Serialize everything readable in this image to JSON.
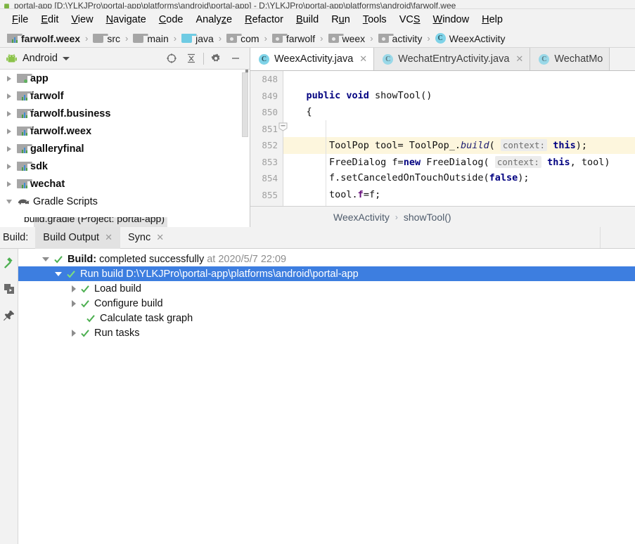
{
  "window": {
    "title": "portal-app [D:\\YLKJPro\\portal-app\\platforms\\android\\portal-app] - D:\\YLKJPro\\portal-app\\platforms\\android\\farwolf.wee",
    "app_icon": "android-icon"
  },
  "menubar": {
    "items": [
      {
        "label": "File",
        "mnemonic": "F"
      },
      {
        "label": "Edit",
        "mnemonic": "E"
      },
      {
        "label": "View",
        "mnemonic": "V"
      },
      {
        "label": "Navigate",
        "mnemonic": "N"
      },
      {
        "label": "Code",
        "mnemonic": "C"
      },
      {
        "label": "Analyze",
        "mnemonic": "z"
      },
      {
        "label": "Refactor",
        "mnemonic": "R"
      },
      {
        "label": "Build",
        "mnemonic": "B"
      },
      {
        "label": "Run",
        "mnemonic": "u"
      },
      {
        "label": "Tools",
        "mnemonic": "T"
      },
      {
        "label": "VCS",
        "mnemonic": "S"
      },
      {
        "label": "Window",
        "mnemonic": "W"
      },
      {
        "label": "Help",
        "mnemonic": "H"
      }
    ]
  },
  "breadcrumb": {
    "items": [
      {
        "label": "farwolf.weex",
        "icon": "module-icon",
        "bold": true
      },
      {
        "label": "src",
        "icon": "folder-icon"
      },
      {
        "label": "main",
        "icon": "folder-icon"
      },
      {
        "label": "java",
        "icon": "folder-source-icon"
      },
      {
        "label": "com",
        "icon": "package-icon"
      },
      {
        "label": "farwolf",
        "icon": "package-icon"
      },
      {
        "label": "weex",
        "icon": "package-icon"
      },
      {
        "label": "activity",
        "icon": "package-icon"
      },
      {
        "label": "WeexActivity",
        "icon": "class-icon"
      }
    ],
    "separator": "›"
  },
  "project_panel": {
    "header": {
      "view_name": "Android",
      "dropdown_icon": "chevron-down-icon",
      "tools": [
        {
          "name": "select-opened-file-icon"
        },
        {
          "name": "collapse-all-icon"
        },
        {
          "name": "gear-icon"
        },
        {
          "name": "hide-icon"
        }
      ]
    },
    "tree": [
      {
        "label": "app",
        "icon": "app-module-icon",
        "expander": "right"
      },
      {
        "label": "farwolf",
        "icon": "module-icon",
        "expander": "right"
      },
      {
        "label": "farwolf.business",
        "icon": "module-icon",
        "expander": "right"
      },
      {
        "label": "farwolf.weex",
        "icon": "module-icon",
        "expander": "right"
      },
      {
        "label": "galleryfinal",
        "icon": "module-icon",
        "expander": "right"
      },
      {
        "label": "sdk",
        "icon": "module-icon",
        "expander": "right"
      },
      {
        "label": "wechat",
        "icon": "module-icon",
        "expander": "right"
      },
      {
        "label": "Gradle Scripts",
        "icon": "gradle-elephant-icon",
        "expander": "down",
        "bold": false
      }
    ],
    "clipped_row": "build.gradle (Project: portal-app)"
  },
  "editor": {
    "tabs": [
      {
        "label": "WeexActivity.java",
        "icon": "class-icon",
        "active": true,
        "closable": true
      },
      {
        "label": "WechatEntryActivity.java",
        "icon": "class-icon",
        "active": false,
        "closable": true
      },
      {
        "label": "WechatMo",
        "icon": "class-icon",
        "active": false,
        "closable": false
      }
    ],
    "gutter_lines": [
      "848",
      "849",
      "850",
      "851",
      "852",
      "853",
      "854",
      "855"
    ],
    "highlighted_line": "852",
    "fold_marker_line": "850",
    "code": [
      {
        "line": "848",
        "tokens": []
      },
      {
        "line": "849",
        "tokens": [
          {
            "t": "    ",
            "c": "plain"
          },
          {
            "t": "public void",
            "c": "keyword"
          },
          {
            "t": " showTool()",
            "c": "plain"
          }
        ]
      },
      {
        "line": "850",
        "tokens": [
          {
            "t": "    {",
            "c": "plain"
          }
        ]
      },
      {
        "line": "851",
        "tokens": []
      },
      {
        "line": "852",
        "tokens": [
          {
            "t": "        ToolPop tool= ToolPop_.",
            "c": "plain"
          },
          {
            "t": "build",
            "c": "italic"
          },
          {
            "t": "( ",
            "c": "plain"
          },
          {
            "t": "context:",
            "c": "hint"
          },
          {
            "t": " ",
            "c": "plain"
          },
          {
            "t": "this",
            "c": "keyword"
          },
          {
            "t": ");",
            "c": "plain"
          }
        ]
      },
      {
        "line": "853",
        "tokens": [
          {
            "t": "        FreeDialog f=",
            "c": "plain"
          },
          {
            "t": "new",
            "c": "keyword"
          },
          {
            "t": " FreeDialog( ",
            "c": "plain"
          },
          {
            "t": "context:",
            "c": "hint"
          },
          {
            "t": " ",
            "c": "plain"
          },
          {
            "t": "this",
            "c": "keyword"
          },
          {
            "t": ", tool)",
            "c": "plain"
          }
        ]
      },
      {
        "line": "854",
        "tokens": [
          {
            "t": "        f.setCanceledOnTouchOutside(",
            "c": "plain"
          },
          {
            "t": "false",
            "c": "keyword"
          },
          {
            "t": ");",
            "c": "plain"
          }
        ]
      },
      {
        "line": "855",
        "tokens": [
          {
            "t": "        tool.",
            "c": "plain"
          },
          {
            "t": "f",
            "c": "field"
          },
          {
            "t": "=f;",
            "c": "plain"
          }
        ]
      }
    ],
    "breadcrumb": {
      "class": "WeexActivity",
      "separator": "›",
      "method": "showTool()"
    }
  },
  "build_window": {
    "label": "Build:",
    "tabs": [
      {
        "label": "Build Output",
        "selected": true,
        "closable": true
      },
      {
        "label": "Sync",
        "selected": false,
        "closable": true
      }
    ],
    "toolbar_icons": [
      {
        "name": "build-hammer-icon"
      },
      {
        "name": "toggle-view-icon"
      },
      {
        "name": "pin-tab-icon"
      }
    ],
    "tree": [
      {
        "expander": "down",
        "status": "success",
        "indent": 0,
        "bold_text": "Build:",
        "text": " completed successfully",
        "dim_text": " at 2020/5/7 22:09",
        "selected": false
      },
      {
        "expander": "down",
        "status": "success",
        "indent": 1,
        "bold_text": "",
        "text": "Run build D:\\YLKJPro\\portal-app\\platforms\\android\\portal-app",
        "dim_text": "",
        "selected": true
      },
      {
        "expander": "right",
        "status": "success",
        "indent": 2,
        "bold_text": "",
        "text": "Load build",
        "dim_text": "",
        "selected": false
      },
      {
        "expander": "right",
        "status": "success",
        "indent": 2,
        "bold_text": "",
        "text": "Configure build",
        "dim_text": "",
        "selected": false
      },
      {
        "expander": "none",
        "status": "success",
        "indent": 2,
        "bold_text": "",
        "text": "Calculate task graph",
        "dim_text": "",
        "selected": false
      },
      {
        "expander": "right",
        "status": "success",
        "indent": 2,
        "bold_text": "",
        "text": "Run tasks",
        "dim_text": "",
        "selected": false
      }
    ]
  },
  "colors": {
    "selection_blue": "#3d7ee0",
    "success_green": "#4caf50",
    "chrome_gray": "#f2f2f2",
    "highlight_line": "#fdf6dd",
    "keyword_navy": "#000080",
    "class_icon_blue": "#7fd3e8"
  }
}
